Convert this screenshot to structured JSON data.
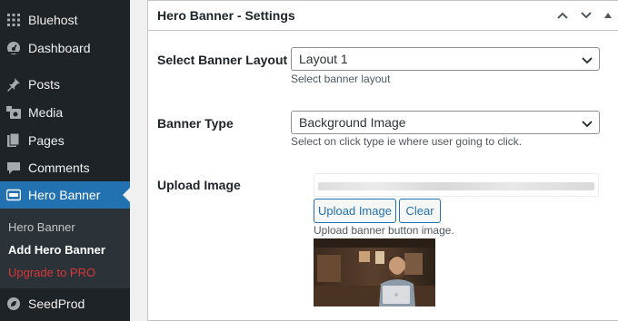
{
  "sidebar": {
    "items": [
      {
        "label": "Bluehost",
        "icon": "grid-icon"
      },
      {
        "label": "Dashboard",
        "icon": "dashboard-icon"
      },
      {
        "label": "Posts",
        "icon": "pin-icon"
      },
      {
        "label": "Media",
        "icon": "media-icon"
      },
      {
        "label": "Pages",
        "icon": "pages-icon"
      },
      {
        "label": "Comments",
        "icon": "comment-icon"
      },
      {
        "label": "Hero Banner",
        "icon": "hero-banner-icon",
        "active": true
      },
      {
        "label": "SeedProd",
        "icon": "seedprod-icon"
      }
    ],
    "submenu": [
      {
        "label": "Hero Banner"
      },
      {
        "label": "Add Hero Banner",
        "current": true
      },
      {
        "label": "Upgrade to PRO"
      }
    ]
  },
  "panel": {
    "title": "Hero Banner - Settings",
    "layout_label": "Select Banner Layout",
    "layout_value": "Layout 1",
    "layout_desc": "Select banner layout",
    "type_label": "Banner Type",
    "type_value": "Background Image",
    "type_desc": "Select on click type ie where user going to click.",
    "upload_label": "Upload Image",
    "upload_button": "Upload Image",
    "clear_button": "Clear",
    "upload_desc": "Upload banner button image."
  },
  "colors": {
    "sidebar_bg": "#1d2327",
    "active": "#2271b1",
    "upgrade": "#d63638"
  }
}
